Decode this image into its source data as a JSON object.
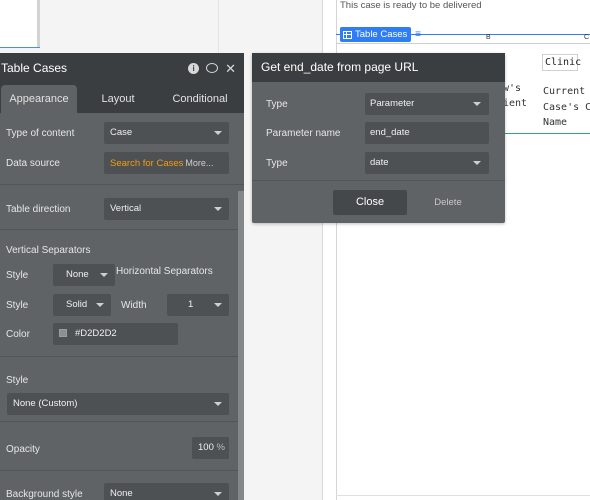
{
  "canvas": {
    "delivered_text": "This case is ready to be delivered",
    "table_tag": "Table Cases",
    "col_b": "B",
    "col_c": "C",
    "clinic_cell": "Clinic",
    "current_cell": "Current\nCase's C\nName",
    "partial_cell": "w's\nient"
  },
  "panel": {
    "title": "Table Cases",
    "tabs": [
      "Appearance",
      "Layout",
      "Conditional"
    ],
    "type_of_content_label": "Type of content",
    "type_of_content_value": "Case",
    "data_source_label": "Data source",
    "data_source_value": "Search for Cases",
    "data_source_more": "More...",
    "table_direction_label": "Table direction",
    "table_direction_value": "Vertical",
    "vertical_separators_label": "Vertical Separators",
    "vs_style_label": "Style",
    "vs_style_value": "None",
    "horizontal_separators_label": "Horizontal Separators",
    "hs_style_label": "Style",
    "hs_style_value": "Solid",
    "width_label": "Width",
    "width_value": "1",
    "color_label": "Color",
    "color_value": "#D2D2D2",
    "style_label": "Style",
    "style_value": "None (Custom)",
    "opacity_label": "Opacity",
    "opacity_value": "100",
    "opacity_unit": "%",
    "background_style_label": "Background style",
    "background_style_value": "None"
  },
  "popup": {
    "title": "Get end_date from page URL",
    "type_label": "Type",
    "type_value": "Parameter",
    "param_name_label": "Parameter name",
    "param_name_value": "end_date",
    "type2_label": "Type",
    "type2_value": "date",
    "close_label": "Close",
    "delete_label": "Delete"
  },
  "icons": {
    "info": "info-icon",
    "comment": "comment-icon",
    "close": "close-icon",
    "table": "table-icon",
    "database": "database-icon"
  },
  "colors": {
    "accent": "#2f7df6",
    "panel_bg": "#5f6365",
    "panel_header": "#3a3e40",
    "data_source": "#f39c12"
  }
}
